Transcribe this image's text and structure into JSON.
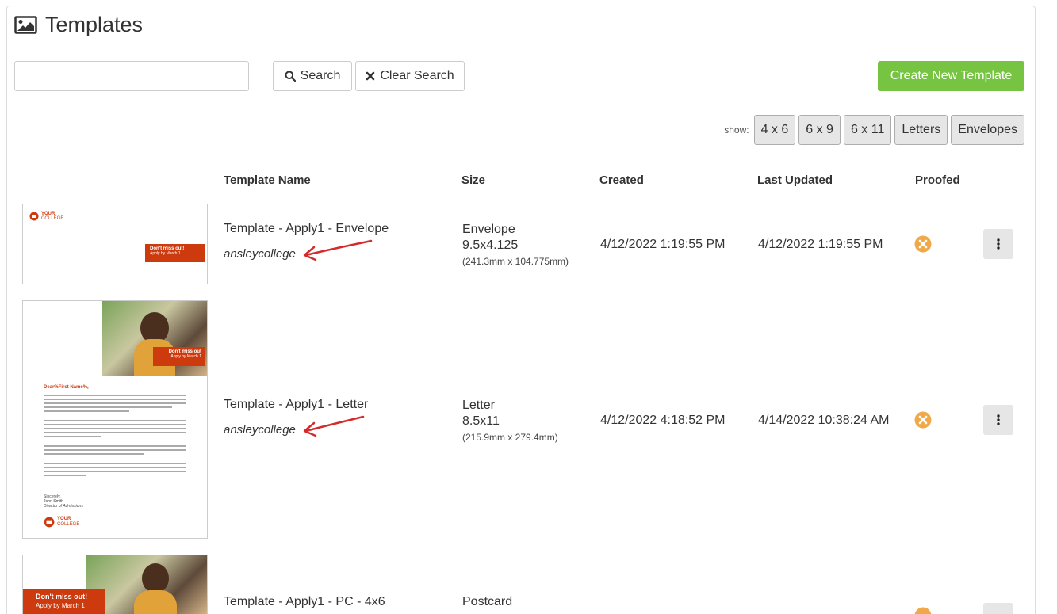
{
  "header": {
    "title": "Templates",
    "icon": "image-icon"
  },
  "search": {
    "value": "",
    "placeholder": "",
    "search_label": "Search",
    "clear_label": "Clear Search"
  },
  "create_label": "Create New Template",
  "filters": {
    "label": "show:",
    "options": [
      "4 x 6",
      "6 x 9",
      "6 x 11",
      "Letters",
      "Envelopes"
    ]
  },
  "columns": {
    "name": "Template Name",
    "size": "Size",
    "created": "Created",
    "updated": "Last Updated",
    "proofed": "Proofed"
  },
  "rows": [
    {
      "name": "Template - Apply1 - Envelope",
      "owner": "ansleycollege",
      "size_type": "Envelope",
      "size_dim": "9.5x4.125",
      "size_mm": "(241.3mm x 104.775mm)",
      "created": "4/12/2022 1:19:55 PM",
      "updated": "4/12/2022 1:19:55 PM",
      "proofed": false
    },
    {
      "name": "Template - Apply1 - Letter",
      "owner": "ansleycollege",
      "size_type": "Letter",
      "size_dim": "8.5x11",
      "size_mm": "(215.9mm x 279.4mm)",
      "created": "4/12/2022 4:18:52 PM",
      "updated": "4/14/2022 10:38:24 AM",
      "proofed": false
    },
    {
      "name": "Template - Apply1 - PC - 4x6",
      "size_type": "Postcard",
      "proofed": false
    }
  ],
  "thumbs": {
    "logo_line1": "YOUR",
    "logo_line2": "COLLEGE",
    "cta_title": "Don't miss out!",
    "cta_sub": "Apply by March 1",
    "letter_cta_title": "Don't miss out",
    "letter_greeting": "Dear%First Name%,",
    "letter_sign1": "Sincerely,",
    "letter_sign2": "John Smith",
    "letter_sign3": "Director of Admissions"
  },
  "colors": {
    "accent_green": "#76c442",
    "brand_red": "#cc3a0e",
    "proof_orange": "#f0a848"
  }
}
